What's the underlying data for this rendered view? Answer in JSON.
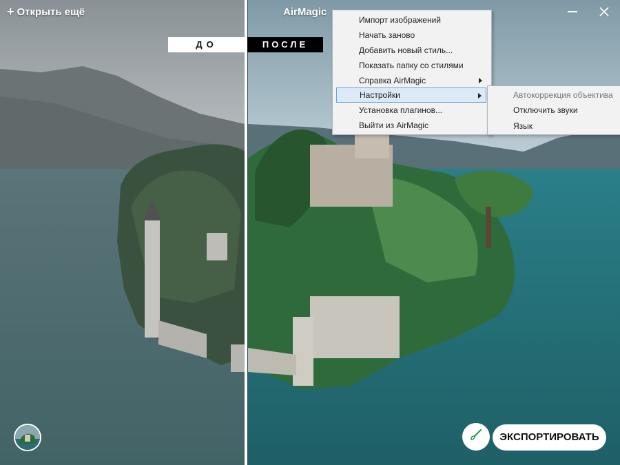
{
  "header": {
    "open_more_label": "Открыть ещё",
    "open_more_icon": "plus-icon",
    "app_title": "AirMagic",
    "minimize_icon": "minimize-icon",
    "close_icon": "close-icon"
  },
  "compare": {
    "before_label": "ДО",
    "after_label": "ПОСЛЕ"
  },
  "menu": {
    "items": [
      {
        "label": "Импорт изображений",
        "has_submenu": false
      },
      {
        "label": "Начать заново",
        "has_submenu": false
      },
      {
        "label": "Добавить новый стиль...",
        "has_submenu": false
      },
      {
        "label": "Показать папку со стилями",
        "has_submenu": false
      },
      {
        "label": "Справка AirMagic",
        "has_submenu": true
      },
      {
        "label": "Настройки",
        "has_submenu": true,
        "selected": true
      },
      {
        "label": "Установка плагинов...",
        "has_submenu": false
      },
      {
        "label": "Выйти из AirMagic",
        "has_submenu": false
      }
    ],
    "submenu": [
      {
        "label": "Автокоррекция объектива",
        "enabled": false
      },
      {
        "label": "Отключить звуки",
        "enabled": true
      },
      {
        "label": "Язык",
        "enabled": true
      }
    ]
  },
  "footer": {
    "export_label": "ЭКСПОРТИРОВАТЬ",
    "brush_icon": "brush-icon",
    "thumbnail": "image-thumbnail"
  },
  "colors": {
    "accent_selected": "#dce9f7",
    "selected_border": "#6aa0d8"
  }
}
